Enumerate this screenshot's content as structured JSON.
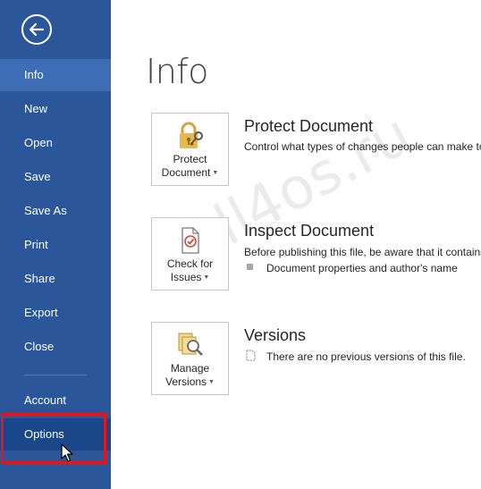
{
  "sidebar": {
    "items": [
      {
        "label": "Info"
      },
      {
        "label": "New"
      },
      {
        "label": "Open"
      },
      {
        "label": "Save"
      },
      {
        "label": "Save As"
      },
      {
        "label": "Print"
      },
      {
        "label": "Share"
      },
      {
        "label": "Export"
      },
      {
        "label": "Close"
      },
      {
        "label": "Account"
      },
      {
        "label": "Options"
      }
    ]
  },
  "main": {
    "title": "Info",
    "sections": [
      {
        "button_line1": "Protect",
        "button_line2": "Document",
        "heading": "Protect Document",
        "description": "Control what types of changes people can make to"
      },
      {
        "button_line1": "Check for",
        "button_line2": "Issues",
        "heading": "Inspect Document",
        "description": "Before publishing this file, be aware that it contains",
        "bullet": "Document properties and author's name"
      },
      {
        "button_line1": "Manage",
        "button_line2": "Versions",
        "heading": "Versions",
        "bullet": "There are no previous versions of this file."
      }
    ]
  },
  "watermark": "All4os.ru",
  "colors": {
    "sidebar": "#2b579a",
    "sidebar_active": "#3e6db5",
    "highlight_box": "#e0181e"
  }
}
